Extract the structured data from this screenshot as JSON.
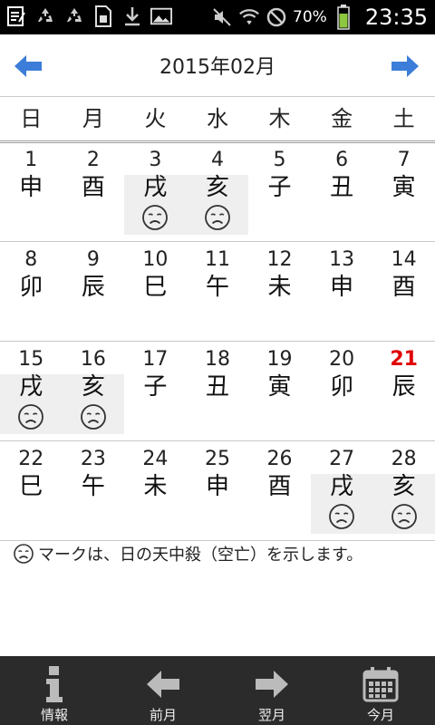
{
  "status_bar": {
    "battery_percent": "70%",
    "time": "23:35",
    "left_icons": [
      "notes-icon",
      "recycle-icon",
      "recycle-icon",
      "sim-icon",
      "download-icon",
      "image-icon"
    ],
    "right_icons": [
      "mute-icon",
      "wifi-icon",
      "no-signal-icon",
      "battery-icon"
    ]
  },
  "header": {
    "title": "2015年02月",
    "prev_icon": "arrow-left-icon",
    "next_icon": "arrow-right-icon",
    "accent_color": "#3b7dd8"
  },
  "weekdays": [
    "日",
    "月",
    "火",
    "水",
    "木",
    "金",
    "土"
  ],
  "weeks": [
    [
      {
        "day": "1",
        "eto": "申"
      },
      {
        "day": "2",
        "eto": "酉"
      },
      {
        "day": "3",
        "eto": "戌",
        "kuubou": true
      },
      {
        "day": "4",
        "eto": "亥",
        "kuubou": true
      },
      {
        "day": "5",
        "eto": "子"
      },
      {
        "day": "6",
        "eto": "丑"
      },
      {
        "day": "7",
        "eto": "寅"
      }
    ],
    [
      {
        "day": "8",
        "eto": "卯"
      },
      {
        "day": "9",
        "eto": "辰"
      },
      {
        "day": "10",
        "eto": "巳"
      },
      {
        "day": "11",
        "eto": "午"
      },
      {
        "day": "12",
        "eto": "未"
      },
      {
        "day": "13",
        "eto": "申"
      },
      {
        "day": "14",
        "eto": "酉"
      }
    ],
    [
      {
        "day": "15",
        "eto": "戌",
        "kuubou": true
      },
      {
        "day": "16",
        "eto": "亥",
        "kuubou": true
      },
      {
        "day": "17",
        "eto": "子"
      },
      {
        "day": "18",
        "eto": "丑"
      },
      {
        "day": "19",
        "eto": "寅"
      },
      {
        "day": "20",
        "eto": "卯"
      },
      {
        "day": "21",
        "eto": "辰",
        "today": true
      }
    ],
    [
      {
        "day": "22",
        "eto": "巳"
      },
      {
        "day": "23",
        "eto": "午"
      },
      {
        "day": "24",
        "eto": "未"
      },
      {
        "day": "25",
        "eto": "申"
      },
      {
        "day": "26",
        "eto": "酉"
      },
      {
        "day": "27",
        "eto": "戌",
        "kuubou": true
      },
      {
        "day": "28",
        "eto": "亥",
        "kuubou": true
      }
    ]
  ],
  "today_color": "#e00000",
  "legend": {
    "icon": "sad-face-icon",
    "text": "マークは、日の天中殺（空亡）を示します。"
  },
  "toolbar": {
    "info_label": "情報",
    "prev_label": "前月",
    "next_label": "翌月",
    "current_label": "今月"
  }
}
